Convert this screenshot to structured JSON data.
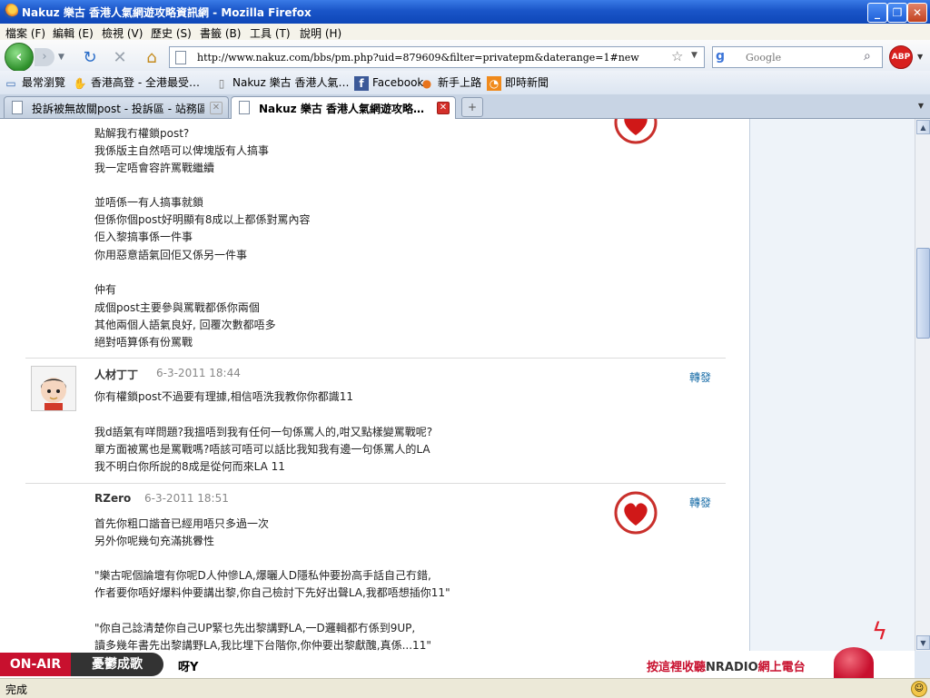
{
  "window": {
    "title": "Nakuz 樂古 香港人氣網遊攻略資訊網 - Mozilla Firefox",
    "controls": [
      "_",
      "❐",
      "✕"
    ]
  },
  "menu": [
    "檔案 (F)",
    "編輯 (E)",
    "檢視 (V)",
    "歷史 (S)",
    "書籤 (B)",
    "工具 (T)",
    "說明 (H)"
  ],
  "nav": {
    "url": "http://www.nakuz.com/bbs/pm.php?uid=879609&filter=privatepm&daterange=1#new",
    "search_placeholder": "Google",
    "search_engine_icon": "google-icon",
    "adblock_label": "ABP"
  },
  "bookmarks": [
    {
      "label": "最常瀏覽",
      "icon": "bookmark-icon"
    },
    {
      "label": "香港高登 - 全港最受…",
      "icon": "hand-icon"
    },
    {
      "label": "Nakuz 樂古 香港人氣…",
      "icon": "page-icon"
    },
    {
      "label": "Facebook",
      "icon": "facebook-icon"
    },
    {
      "label": "新手上路",
      "icon": "firefox-icon"
    },
    {
      "label": "即時新聞",
      "icon": "rss-icon"
    }
  ],
  "tabs": [
    {
      "label": "投訴被無故關post - 投訴區 - 站務區 …",
      "active": false
    },
    {
      "label": "Nakuz 樂古 香港人氣網遊攻略…",
      "active": true
    }
  ],
  "messages": {
    "first_body": [
      "點解我冇權鎖post?",
      "我係版主自然唔可以俾塊版有人搞事",
      "我一定唔會容許罵戰繼續",
      "",
      "並唔係一有人搞事就鎖",
      "但係你個post好明顯有8成以上都係對罵內容",
      "佢入黎搞事係一件事",
      "你用惡意語氣回佢又係另一件事",
      "",
      "仲有",
      "成個post主要參與罵戰都係你兩個",
      "其他兩個人語氣良好, 回覆次數都唔多",
      "絕對唔算係有份罵戰"
    ],
    "second": {
      "author": "人材丁丁",
      "date": "6-3-2011 18:44",
      "reply": "轉發",
      "body": [
        "你有權鎖post不過要有理據,相信唔洗我教你你都識11",
        "",
        "我d語氣有咩問題?我搵唔到我有任何一句係罵人的,咁又點樣變罵戰呢?",
        "單方面被罵也是罵戰嗎?唔該可唔可以話比我知我有邊一句係罵人的LA",
        "我不明白你所說的8成是從何而來LA 11"
      ]
    },
    "third": {
      "author": "RZero",
      "date": "6-3-2011 18:51",
      "reply": "轉發",
      "body": [
        "首先你粗口諧音已經用唔只多過一次",
        "另外你呢幾句充滿挑釁性",
        "",
        "\"樂古呢個論壇有你呢D人仲慘LA,爆曬人D隱私仲要扮高手話自己冇錯,",
        "作者要你唔好爆料仲要講出黎,你自己檢討下先好出聲LA,我都唔想插你11\"",
        "",
        "\"你自己諗清楚你自己UP緊乜先出黎講野LA,一D邏輯都冇係到9UP,",
        "讀多幾年書先出黎講野LA,我比埋下台階你,你仲要出黎獻醜,真係...11\""
      ]
    }
  },
  "radio": {
    "onair": "ON-AIR",
    "song": "憂鬱成歌",
    "artist": "呀Y",
    "cta_prefix": "按這裡收聽",
    "cta_brand": "NRADIO",
    "cta_suffix": "網上電台"
  },
  "status": {
    "text": "完成"
  }
}
